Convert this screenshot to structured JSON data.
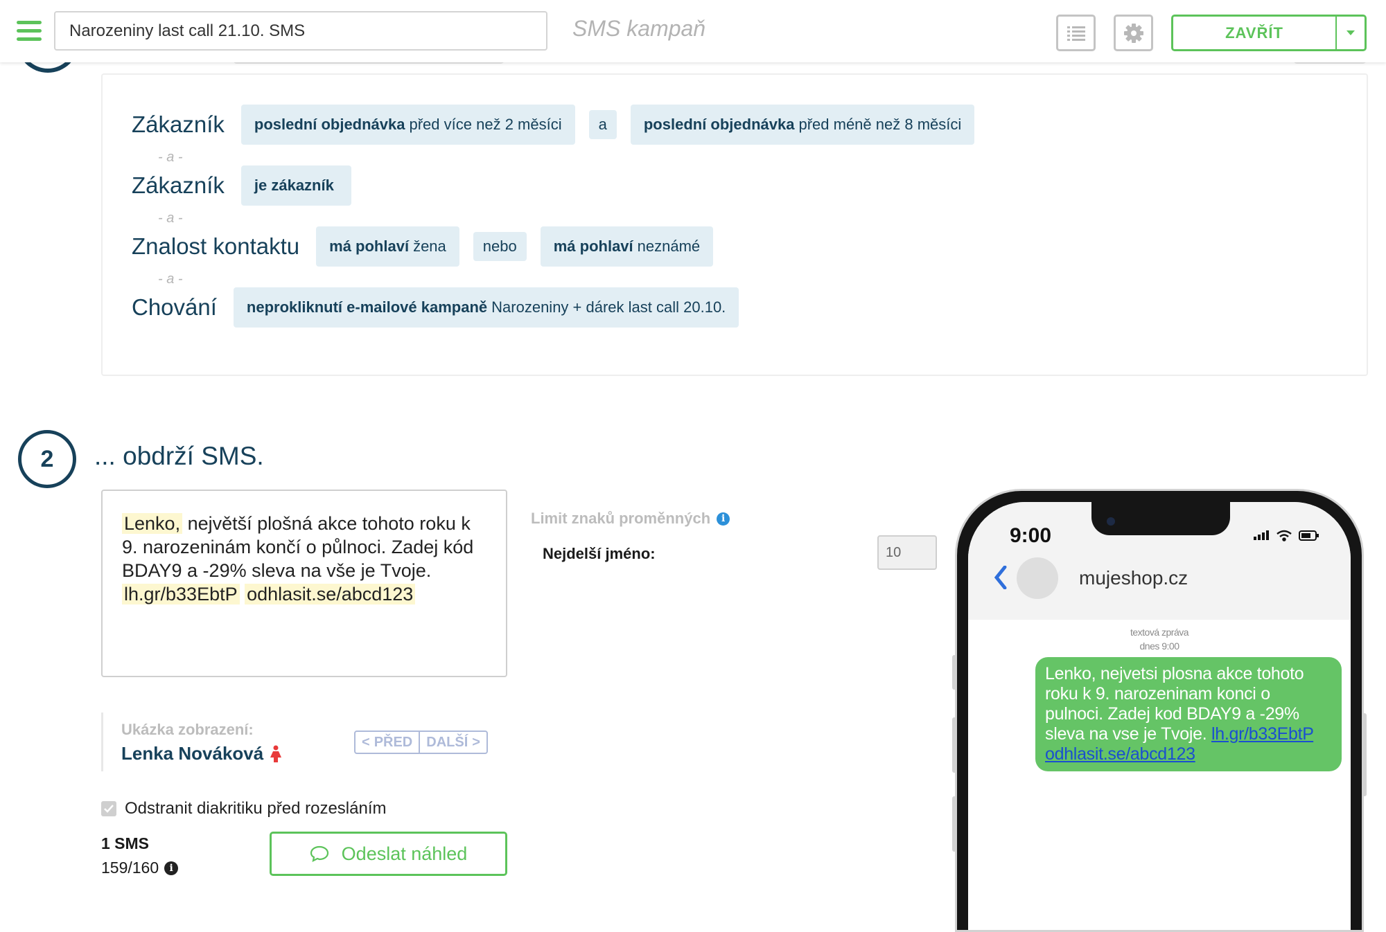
{
  "header": {
    "campaign_name": "Narozeniny last call 21.10. SMS",
    "campaign_type": "SMS kampaň",
    "close_label": "ZAVŘÍT"
  },
  "filters": {
    "and_label": "- a -",
    "rows": [
      {
        "label": "Zákazník",
        "chips": [
          {
            "bold": "poslední objednávka",
            "text": "před více než 2 měsíci"
          },
          {
            "bold": "poslední objednávka",
            "text": "před méně než 8 měsíci"
          }
        ],
        "operator": "a"
      },
      {
        "label": "Zákazník",
        "chips": [
          {
            "bold": "je zákazník",
            "text": ""
          }
        ]
      },
      {
        "label": "Znalost kontaktu",
        "chips": [
          {
            "bold": "má pohlaví",
            "text": "žena"
          },
          {
            "bold": "má pohlaví",
            "text": "neznámé"
          }
        ],
        "operator": "nebo"
      },
      {
        "label": "Chování",
        "chips": [
          {
            "bold": "neprokliknutí e-mailové kampaně",
            "text": "Narozeniny + dárek last call 20.10."
          }
        ]
      }
    ]
  },
  "step2": {
    "number": "2",
    "title": "... obdrží SMS.",
    "message": {
      "var_name": "Lenko,",
      "body": "největší plošná akce tohoto roku k 9. narozeninám končí o půlnoci. Zadej kód BDAY9 a -29% sleva na vše je Tvoje.",
      "link": "lh.gr/b33EbtP",
      "unsub": "odhlasit.se/abcd123"
    },
    "limit_title": "Limit znaků proměnných",
    "longest_name_label": "Nejdelší jméno:",
    "longest_name_value": "10",
    "preview_caption": "Ukázka zobrazení:",
    "preview_name": "Lenka Nováková",
    "prev_label": "PŘED",
    "next_label": "DALŠÍ",
    "remove_diacritics_label": "Odstranit diakritiku před rozesláním",
    "sms_count": "1 SMS",
    "char_count": "159/160",
    "send_preview_label": "Odeslat náhled"
  },
  "phone": {
    "time": "9:00",
    "sender": "mujeshop.cz",
    "meta_type": "textová zpráva",
    "meta_time": "dnes 9:00",
    "bubble_text": "Lenko, nejvetsi plosna akce tohoto roku k 9. narozeninam konci o pulnoci. Zadej kod BDAY9 a -29% sleva na vse je Tvoje.",
    "bubble_link": "lh.gr/b33EbtP",
    "bubble_unsub": "odhlasit.se/abcd123"
  },
  "colors": {
    "accent_green": "#5cc35a",
    "navy": "#17415a",
    "chip_bg": "#e2eef4",
    "highlight": "#fdf7d0",
    "bubble_green": "#65c466"
  }
}
